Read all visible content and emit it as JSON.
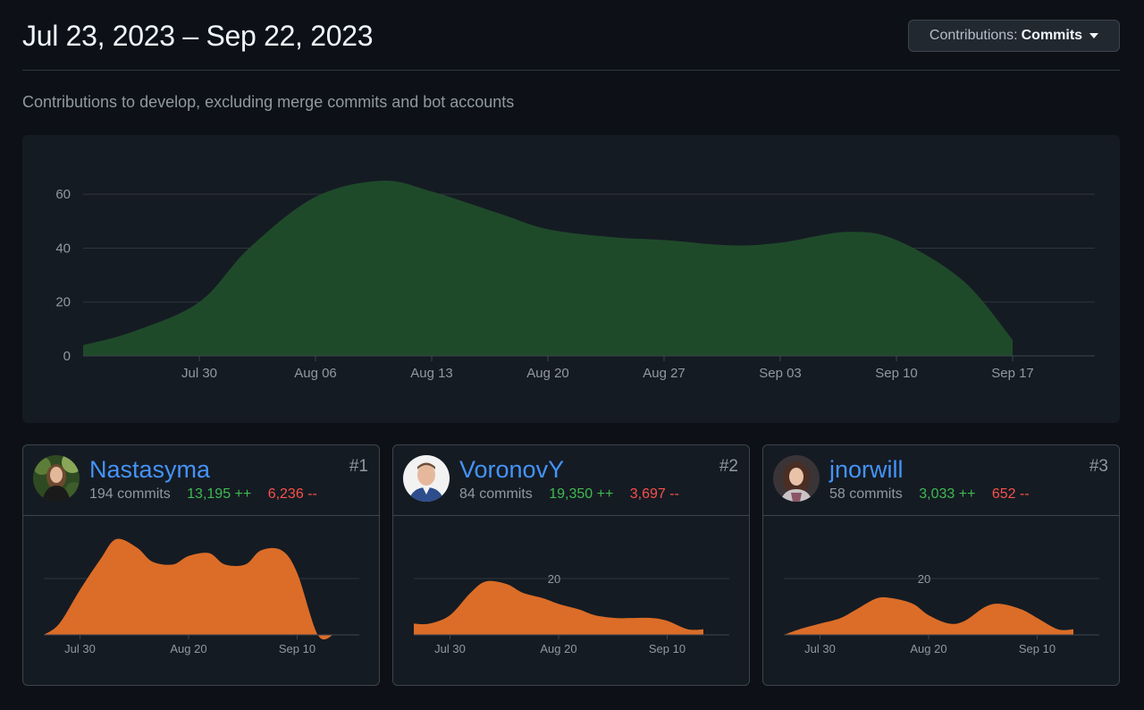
{
  "header": {
    "date_range": "Jul 23, 2023 – Sep 22, 2023",
    "contributions_label": "Contributions:",
    "contributions_value": "Commits"
  },
  "subtitle": "Contributions to develop, excluding merge commits and bot accounts",
  "colors": {
    "main_area": "#1f4a2a",
    "contributor_area": "#db6d28",
    "link": "#4493f8",
    "additions": "#3fb950",
    "deletions": "#f85149"
  },
  "chart_data": [
    {
      "type": "area",
      "x": [
        "Jul 23",
        "Jul 26",
        "Jul 30",
        "Aug 02",
        "Aug 06",
        "Aug 10",
        "Aug 13",
        "Aug 17",
        "Aug 20",
        "Aug 24",
        "Aug 27",
        "Aug 31",
        "Sep 03",
        "Sep 07",
        "Sep 10",
        "Sep 14",
        "Sep 17"
      ],
      "y": [
        4,
        9,
        20,
        40,
        59,
        65,
        61,
        53,
        47,
        44,
        43,
        41,
        42,
        46,
        43,
        28,
        6
      ],
      "xticks": [
        "Jul 30",
        "Aug 06",
        "Aug 13",
        "Aug 20",
        "Aug 27",
        "Sep 03",
        "Sep 10",
        "Sep 17"
      ],
      "yticks": [
        "0",
        "20",
        "40",
        "60"
      ],
      "ylim": [
        0,
        72
      ],
      "grid": true
    },
    {
      "type": "area",
      "x": [
        "Jul 23",
        "Jul 26",
        "Jul 30",
        "Aug 03",
        "Aug 06",
        "Aug 10",
        "Aug 13",
        "Aug 17",
        "Aug 20",
        "Aug 24",
        "Aug 27",
        "Aug 31",
        "Sep 03",
        "Sep 07",
        "Sep 10",
        "Sep 14",
        "Sep 17"
      ],
      "y": [
        0,
        4,
        16,
        27,
        34,
        31,
        26,
        25,
        28,
        29,
        25,
        25,
        30,
        30,
        22,
        0,
        0
      ],
      "xticks": [
        "Jul 30",
        "Aug 20",
        "Sep 10"
      ],
      "yticks": [],
      "ylim": [
        0,
        20
      ],
      "grid": true
    },
    {
      "type": "area",
      "x": [
        "Jul 23",
        "Jul 26",
        "Jul 30",
        "Aug 03",
        "Aug 06",
        "Aug 10",
        "Aug 13",
        "Aug 17",
        "Aug 20",
        "Aug 24",
        "Aug 27",
        "Aug 31",
        "Sep 03",
        "Sep 07",
        "Sep 10",
        "Sep 14",
        "Sep 17"
      ],
      "y": [
        4,
        4,
        7,
        15,
        19,
        18,
        15,
        13,
        11,
        9,
        7,
        6,
        6,
        6,
        5,
        2,
        2
      ],
      "xticks": [
        "Jul 30",
        "Aug 20",
        "Sep 10"
      ],
      "yticks": [
        "20"
      ],
      "ylim": [
        0,
        20
      ],
      "grid": true
    },
    {
      "type": "area",
      "x": [
        "Jul 23",
        "Jul 26",
        "Jul 30",
        "Aug 03",
        "Aug 06",
        "Aug 10",
        "Aug 13",
        "Aug 17",
        "Aug 20",
        "Aug 24",
        "Aug 27",
        "Aug 31",
        "Sep 03",
        "Sep 07",
        "Sep 10",
        "Sep 14",
        "Sep 17"
      ],
      "y": [
        0,
        2,
        4,
        6,
        9,
        13,
        13,
        11,
        7,
        4,
        5,
        10,
        11,
        9,
        6,
        2,
        2
      ],
      "xticks": [
        "Jul 30",
        "Aug 20",
        "Sep 10"
      ],
      "yticks": [
        "20"
      ],
      "ylim": [
        0,
        20
      ],
      "grid": true
    }
  ],
  "contributors": [
    {
      "rank": "#1",
      "name": "Nastasyma",
      "commits": "194 commits",
      "additions": "13,195 ++",
      "deletions": "6,236 --",
      "avatar_icon": "avatar-photo"
    },
    {
      "rank": "#2",
      "name": "VoronovY",
      "commits": "84 commits",
      "additions": "19,350 ++",
      "deletions": "3,697 --",
      "avatar_icon": "avatar-photo"
    },
    {
      "rank": "#3",
      "name": "jnorwill",
      "commits": "58 commits",
      "additions": "3,033 ++",
      "deletions": "652 --",
      "avatar_icon": "avatar-photo"
    }
  ]
}
